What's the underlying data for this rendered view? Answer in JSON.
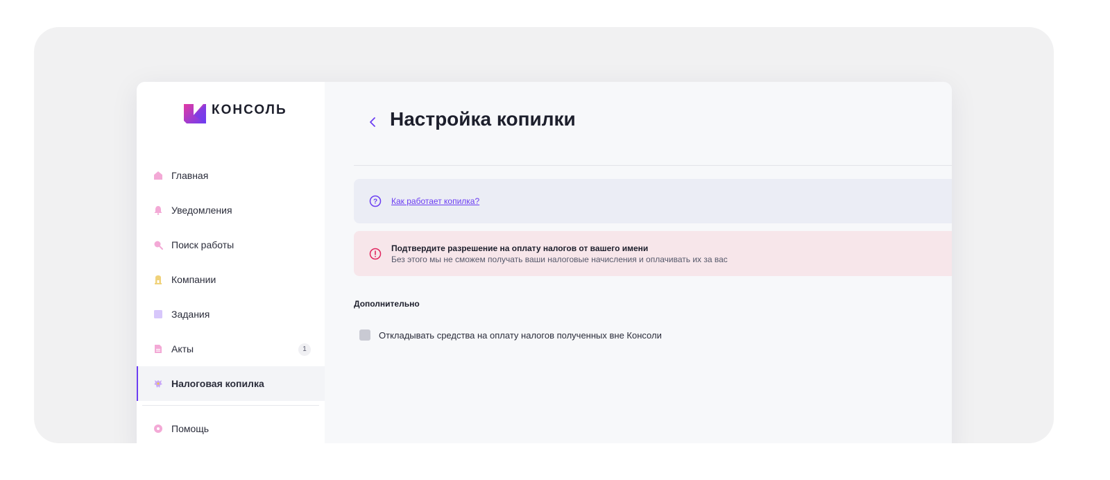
{
  "brand": {
    "name": "КОНСОЛЬ",
    "accent": "#6b3df2",
    "accent_pink": "#e23aa3"
  },
  "sidebar": {
    "items": [
      {
        "label": "Главная",
        "icon": "home-icon",
        "color": "#f3a9d6"
      },
      {
        "label": "Уведомления",
        "icon": "bell-icon",
        "color": "#f3a9d6"
      },
      {
        "label": "Поиск работы",
        "icon": "search-icon",
        "color": "#f3a9d6"
      },
      {
        "label": "Компании",
        "icon": "building-icon",
        "color": "#f0d27a"
      },
      {
        "label": "Задания",
        "icon": "tasks-icon",
        "color": "#d7c7fb"
      },
      {
        "label": "Акты",
        "icon": "document-icon",
        "color": "#f3a9d6",
        "badge": "1"
      },
      {
        "label": "Налоговая копилка",
        "icon": "emblem-icon",
        "color": "#c9a7f7",
        "active": true
      }
    ],
    "footer_items": [
      {
        "label": "Помощь",
        "icon": "help-icon",
        "color": "#f3a9d6"
      }
    ]
  },
  "header": {
    "back_icon": "chevron-left-icon",
    "title": "Настройка копилки"
  },
  "info_banner": {
    "icon": "question-circle-icon",
    "link": "Как работает копилка?"
  },
  "warning_banner": {
    "icon": "exclamation-circle-icon",
    "title": "Подтвердите разрешение на оплату налогов от вашего имени",
    "subtitle": "Без этого мы не сможем получать ваши налоговые начисления и оплачивать их за вас"
  },
  "extra_section": {
    "title": "Дополнительно",
    "checkbox_label": "Откладывать средства на оплату налогов полученных вне Консоли",
    "checkbox_checked": false
  }
}
